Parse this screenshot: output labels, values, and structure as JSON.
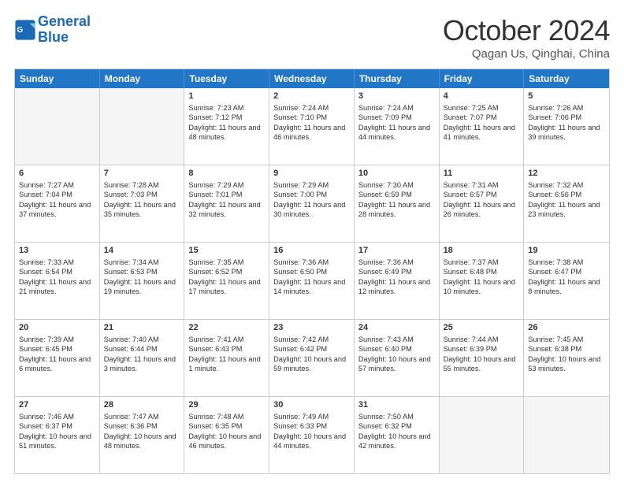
{
  "header": {
    "logo_line1": "General",
    "logo_line2": "Blue",
    "month_title": "October 2024",
    "location": "Qagan Us, Qinghai, China"
  },
  "days_of_week": [
    "Sunday",
    "Monday",
    "Tuesday",
    "Wednesday",
    "Thursday",
    "Friday",
    "Saturday"
  ],
  "weeks": [
    [
      {
        "day": "",
        "sunrise": "",
        "sunset": "",
        "daylight": "",
        "empty": true
      },
      {
        "day": "",
        "sunrise": "",
        "sunset": "",
        "daylight": "",
        "empty": true
      },
      {
        "day": "1",
        "sunrise": "Sunrise: 7:23 AM",
        "sunset": "Sunset: 7:12 PM",
        "daylight": "Daylight: 11 hours and 48 minutes."
      },
      {
        "day": "2",
        "sunrise": "Sunrise: 7:24 AM",
        "sunset": "Sunset: 7:10 PM",
        "daylight": "Daylight: 11 hours and 46 minutes."
      },
      {
        "day": "3",
        "sunrise": "Sunrise: 7:24 AM",
        "sunset": "Sunset: 7:09 PM",
        "daylight": "Daylight: 11 hours and 44 minutes."
      },
      {
        "day": "4",
        "sunrise": "Sunrise: 7:25 AM",
        "sunset": "Sunset: 7:07 PM",
        "daylight": "Daylight: 11 hours and 41 minutes."
      },
      {
        "day": "5",
        "sunrise": "Sunrise: 7:26 AM",
        "sunset": "Sunset: 7:06 PM",
        "daylight": "Daylight: 11 hours and 39 minutes."
      }
    ],
    [
      {
        "day": "6",
        "sunrise": "Sunrise: 7:27 AM",
        "sunset": "Sunset: 7:04 PM",
        "daylight": "Daylight: 11 hours and 37 minutes."
      },
      {
        "day": "7",
        "sunrise": "Sunrise: 7:28 AM",
        "sunset": "Sunset: 7:03 PM",
        "daylight": "Daylight: 11 hours and 35 minutes."
      },
      {
        "day": "8",
        "sunrise": "Sunrise: 7:29 AM",
        "sunset": "Sunset: 7:01 PM",
        "daylight": "Daylight: 11 hours and 32 minutes."
      },
      {
        "day": "9",
        "sunrise": "Sunrise: 7:29 AM",
        "sunset": "Sunset: 7:00 PM",
        "daylight": "Daylight: 11 hours and 30 minutes."
      },
      {
        "day": "10",
        "sunrise": "Sunrise: 7:30 AM",
        "sunset": "Sunset: 6:59 PM",
        "daylight": "Daylight: 11 hours and 28 minutes."
      },
      {
        "day": "11",
        "sunrise": "Sunrise: 7:31 AM",
        "sunset": "Sunset: 6:57 PM",
        "daylight": "Daylight: 11 hours and 26 minutes."
      },
      {
        "day": "12",
        "sunrise": "Sunrise: 7:32 AM",
        "sunset": "Sunset: 6:56 PM",
        "daylight": "Daylight: 11 hours and 23 minutes."
      }
    ],
    [
      {
        "day": "13",
        "sunrise": "Sunrise: 7:33 AM",
        "sunset": "Sunset: 6:54 PM",
        "daylight": "Daylight: 11 hours and 21 minutes."
      },
      {
        "day": "14",
        "sunrise": "Sunrise: 7:34 AM",
        "sunset": "Sunset: 6:53 PM",
        "daylight": "Daylight: 11 hours and 19 minutes."
      },
      {
        "day": "15",
        "sunrise": "Sunrise: 7:35 AM",
        "sunset": "Sunset: 6:52 PM",
        "daylight": "Daylight: 11 hours and 17 minutes."
      },
      {
        "day": "16",
        "sunrise": "Sunrise: 7:36 AM",
        "sunset": "Sunset: 6:50 PM",
        "daylight": "Daylight: 11 hours and 14 minutes."
      },
      {
        "day": "17",
        "sunrise": "Sunrise: 7:36 AM",
        "sunset": "Sunset: 6:49 PM",
        "daylight": "Daylight: 11 hours and 12 minutes."
      },
      {
        "day": "18",
        "sunrise": "Sunrise: 7:37 AM",
        "sunset": "Sunset: 6:48 PM",
        "daylight": "Daylight: 11 hours and 10 minutes."
      },
      {
        "day": "19",
        "sunrise": "Sunrise: 7:38 AM",
        "sunset": "Sunset: 6:47 PM",
        "daylight": "Daylight: 11 hours and 8 minutes."
      }
    ],
    [
      {
        "day": "20",
        "sunrise": "Sunrise: 7:39 AM",
        "sunset": "Sunset: 6:45 PM",
        "daylight": "Daylight: 11 hours and 6 minutes."
      },
      {
        "day": "21",
        "sunrise": "Sunrise: 7:40 AM",
        "sunset": "Sunset: 6:44 PM",
        "daylight": "Daylight: 11 hours and 3 minutes."
      },
      {
        "day": "22",
        "sunrise": "Sunrise: 7:41 AM",
        "sunset": "Sunset: 6:43 PM",
        "daylight": "Daylight: 11 hours and 1 minute."
      },
      {
        "day": "23",
        "sunrise": "Sunrise: 7:42 AM",
        "sunset": "Sunset: 6:42 PM",
        "daylight": "Daylight: 10 hours and 59 minutes."
      },
      {
        "day": "24",
        "sunrise": "Sunrise: 7:43 AM",
        "sunset": "Sunset: 6:40 PM",
        "daylight": "Daylight: 10 hours and 57 minutes."
      },
      {
        "day": "25",
        "sunrise": "Sunrise: 7:44 AM",
        "sunset": "Sunset: 6:39 PM",
        "daylight": "Daylight: 10 hours and 55 minutes."
      },
      {
        "day": "26",
        "sunrise": "Sunrise: 7:45 AM",
        "sunset": "Sunset: 6:38 PM",
        "daylight": "Daylight: 10 hours and 53 minutes."
      }
    ],
    [
      {
        "day": "27",
        "sunrise": "Sunrise: 7:46 AM",
        "sunset": "Sunset: 6:37 PM",
        "daylight": "Daylight: 10 hours and 51 minutes."
      },
      {
        "day": "28",
        "sunrise": "Sunrise: 7:47 AM",
        "sunset": "Sunset: 6:36 PM",
        "daylight": "Daylight: 10 hours and 48 minutes."
      },
      {
        "day": "29",
        "sunrise": "Sunrise: 7:48 AM",
        "sunset": "Sunset: 6:35 PM",
        "daylight": "Daylight: 10 hours and 46 minutes."
      },
      {
        "day": "30",
        "sunrise": "Sunrise: 7:49 AM",
        "sunset": "Sunset: 6:33 PM",
        "daylight": "Daylight: 10 hours and 44 minutes."
      },
      {
        "day": "31",
        "sunrise": "Sunrise: 7:50 AM",
        "sunset": "Sunset: 6:32 PM",
        "daylight": "Daylight: 10 hours and 42 minutes."
      },
      {
        "day": "",
        "sunrise": "",
        "sunset": "",
        "daylight": "",
        "empty": true
      },
      {
        "day": "",
        "sunrise": "",
        "sunset": "",
        "daylight": "",
        "empty": true
      }
    ]
  ]
}
